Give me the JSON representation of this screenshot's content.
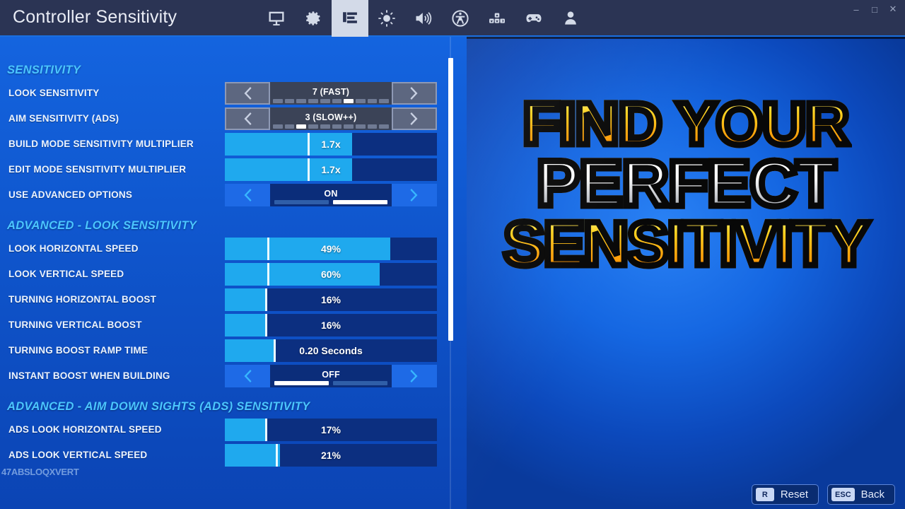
{
  "window": {
    "title": "Controller Sensitivity",
    "controls": {
      "minimize": "–",
      "maximize": "□",
      "close": "✕"
    }
  },
  "nav": {
    "items": [
      {
        "name": "display-icon",
        "label": "Display",
        "active": false
      },
      {
        "name": "settings-gear-icon",
        "label": "Game",
        "active": false
      },
      {
        "name": "list-lines-icon",
        "label": "Sensitivity",
        "active": true
      },
      {
        "name": "brightness-icon",
        "label": "Brightness",
        "active": false
      },
      {
        "name": "audio-speaker-icon",
        "label": "Audio",
        "active": false
      },
      {
        "name": "accessibility-icon",
        "label": "Accessibility",
        "active": false
      },
      {
        "name": "keybinds-icon",
        "label": "Input",
        "active": false
      },
      {
        "name": "gamepad-icon",
        "label": "Controller",
        "active": false
      },
      {
        "name": "account-icon",
        "label": "Account",
        "active": false
      }
    ]
  },
  "sections": [
    {
      "header": "SENSITIVITY",
      "rows": [
        {
          "label": "LOOK SENSITIVITY",
          "type": "stepper",
          "style": "gray",
          "value": "7 (FAST)",
          "ticks": 10,
          "tick_on": 7
        },
        {
          "label": "AIM SENSITIVITY (ADS)",
          "type": "stepper",
          "style": "gray",
          "value": "3 (SLOW++)",
          "ticks": 10,
          "tick_on": 3
        },
        {
          "label": "BUILD MODE SENSITIVITY MULTIPLIER",
          "type": "slider",
          "value": "1.7x",
          "fill_pct": 60,
          "knob_pct": 39
        },
        {
          "label": "EDIT MODE SENSITIVITY MULTIPLIER",
          "type": "slider",
          "value": "1.7x",
          "fill_pct": 60,
          "knob_pct": 39
        },
        {
          "label": "USE ADVANCED OPTIONS",
          "type": "stepper",
          "style": "blue",
          "value": "ON",
          "toggle_segments": 2,
          "toggle_on": 2
        }
      ]
    },
    {
      "header": "ADVANCED - LOOK SENSITIVITY",
      "rows": [
        {
          "label": "LOOK HORIZONTAL SPEED",
          "type": "slider",
          "value": "49%",
          "fill_pct": 78,
          "knob_pct": 20
        },
        {
          "label": "LOOK VERTICAL SPEED",
          "type": "slider",
          "value": "60%",
          "fill_pct": 73,
          "knob_pct": 20
        },
        {
          "label": "TURNING HORIZONTAL BOOST",
          "type": "slider",
          "value": "16%",
          "fill_pct": 20,
          "knob_pct": 19
        },
        {
          "label": "TURNING VERTICAL BOOST",
          "type": "slider",
          "value": "16%",
          "fill_pct": 20,
          "knob_pct": 19
        },
        {
          "label": "TURNING BOOST RAMP TIME",
          "type": "slider",
          "value": "0.20 Seconds",
          "fill_pct": 24,
          "knob_pct": 23
        },
        {
          "label": "INSTANT BOOST WHEN BUILDING",
          "type": "stepper",
          "style": "blue",
          "value": "OFF",
          "toggle_segments": 2,
          "toggle_on": 1
        }
      ]
    },
    {
      "header": "ADVANCED - AIM DOWN SIGHTS (ADS) SENSITIVITY",
      "rows": [
        {
          "label": "ADS LOOK HORIZONTAL SPEED",
          "type": "slider",
          "value": "17%",
          "fill_pct": 20,
          "knob_pct": 19
        },
        {
          "label": "ADS LOOK VERTICAL SPEED",
          "type": "slider",
          "value": "21%",
          "fill_pct": 26,
          "knob_pct": 24
        }
      ]
    }
  ],
  "artifact_text": "47ABSLOQXVERT",
  "thumbnail": {
    "line1": "FIND YOUR",
    "line2": "PERFECT",
    "line3": "SENSITIVITY",
    "line1_color": "#ffd21f",
    "line2_color": "#ffffff",
    "line3_color": "#ffd21f"
  },
  "footer": {
    "buttons": [
      {
        "key": "R",
        "label": "Reset",
        "name": "reset-button"
      },
      {
        "key": "ESC",
        "label": "Back",
        "name": "back-button"
      }
    ]
  },
  "colors": {
    "titlebar_bg": "#2b3454",
    "panel_blue": "#1464df",
    "accent_cyan": "#4bc6ff",
    "slider_fill": "#1fa9ee",
    "slider_track": "#0c2f80"
  }
}
